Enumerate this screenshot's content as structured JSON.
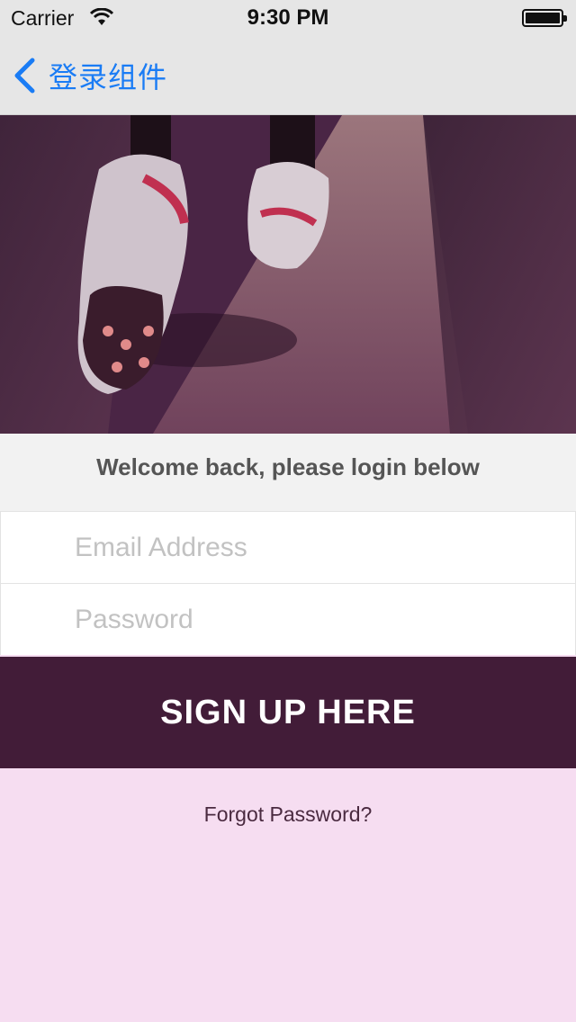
{
  "status_bar": {
    "carrier": "Carrier",
    "time": "9:30 PM"
  },
  "nav": {
    "back_label": "登录组件"
  },
  "welcome": "Welcome back, please login below",
  "form": {
    "email_placeholder": "Email Address",
    "password_placeholder": "Password"
  },
  "signup_label": "SIGN UP HERE",
  "forgot_label": "Forgot Password?",
  "colors": {
    "accent": "#1a7cf5",
    "button": "#421c38",
    "background": "#f6ddf1"
  }
}
